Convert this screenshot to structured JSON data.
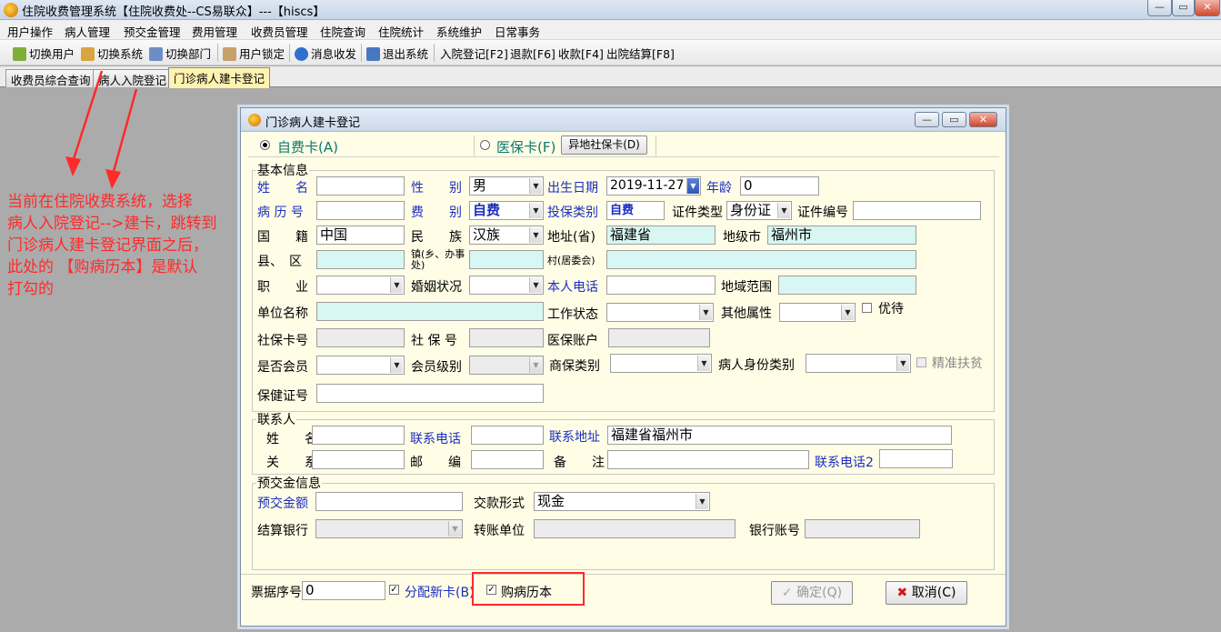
{
  "window": {
    "title": "住院收费管理系统【住院收费处--CS易联众】---【hiscs】",
    "buttons": [
      "—",
      "▭",
      "✕"
    ]
  },
  "menu": [
    "用户操作",
    "病人管理",
    "预交金管理",
    "费用管理",
    "收费员管理",
    "住院查询",
    "住院统计",
    "系统维护",
    "日常事务"
  ],
  "toolbar": [
    "切换用户",
    "切换系统",
    "切换部门",
    "用户锁定",
    "消息收发",
    "退出系统",
    "入院登记[F2]",
    "退款[F6]",
    "收款[F4]",
    "出院结算[F8]"
  ],
  "tabs": [
    "收费员综合查询",
    "病人入院登记",
    "门诊病人建卡登记"
  ],
  "annotation": {
    "lines": [
      "当前在住院收费系统，选择",
      "病人入院登记-->建卡，跳转到",
      "门诊病人建卡登记界面之后，",
      "此处的 【购病历本】是默认",
      "打勾的"
    ]
  },
  "dialog": {
    "title": "门诊病人建卡登记",
    "card_self_pay": "自费卡(A)",
    "card_insurance": "医保卡(F)",
    "remote_card_btn": "异地社保卡(D)",
    "basic_legend": "基本信息",
    "labels": {
      "name": "姓　　名",
      "gender": "性　　别",
      "birth": "出生日期",
      "age": "年龄",
      "record_no": "病 历 号",
      "fee_type": "费　　别",
      "insure_type": "投保类别",
      "id_type": "证件类型",
      "id_no": "证件编号",
      "nation": "国　　籍",
      "ethnic": "民　　族",
      "addr_province": "地址(省)",
      "city": "地级市",
      "county": "县、　区",
      "town": "镇(乡、办事处)",
      "village": "村(居委会)",
      "job": "职　　业",
      "marriage": "婚姻状况",
      "phone": "本人电话",
      "region": "地域范围",
      "employer": "单位名称",
      "work_status": "工作状态",
      "other_attr": "其他属性",
      "vip": "优待",
      "ss_card": "社保卡号",
      "ss_no": "社 保 号",
      "med_account": "医保账户",
      "member": "是否会员",
      "member_level": "会员级别",
      "commercial_ins": "商保类别",
      "patient_id_type": "病人身份类别",
      "poverty": "精准扶贫",
      "health_card": "保健证号"
    },
    "values": {
      "gender": "男",
      "birth": "2019-11-27",
      "age": "0",
      "fee_type": "自费",
      "insure_type": "自费",
      "id_type": "身份证",
      "nation": "中国",
      "ethnic": "汉族",
      "province": "福建省",
      "city": "福州市"
    },
    "contact_legend": "联系人",
    "contact": {
      "name": "姓　　名",
      "phone": "联系电话",
      "address": "联系地址",
      "address_val": "福建省福州市",
      "relation": "关　　系",
      "postcode": "邮　　编",
      "remark": "备　　注",
      "phone2": "联系电话2"
    },
    "deposit_legend": "预交金信息",
    "deposit": {
      "amount": "预交金额",
      "pay_method": "交款形式",
      "pay_method_val": "现金",
      "bank": "结算银行",
      "transfer_unit": "转账单位",
      "bank_account": "银行账号"
    },
    "footer": {
      "receipt_no": "票据序号",
      "receipt_val": "0",
      "assign_new_card": "分配新卡(B)",
      "buy_record_book": "购病历本",
      "confirm": "确定(Q)",
      "cancel": "取消(C)"
    }
  },
  "colors": {
    "annotation": "#ff2a2a",
    "label_blue": "#1c2fc0",
    "field_cyan": "#d8f6f2",
    "dialog_bg": "#fffde6"
  }
}
